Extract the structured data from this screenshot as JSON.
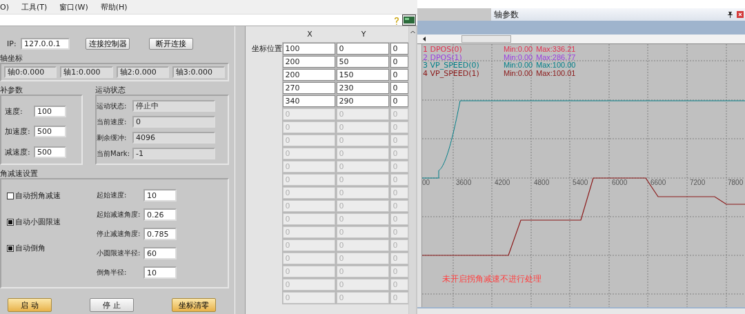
{
  "menu_bar": {
    "items": [
      "O)",
      "工具(T)",
      "窗口(W)",
      "帮助(H)"
    ]
  },
  "connection": {
    "ip_label": "IP:",
    "ip": "127.0.0.1",
    "buttons": [
      "连接控制器",
      "断开连接"
    ]
  },
  "axis_coords": {
    "title": "轴坐标",
    "fields": [
      "轴0:0.000",
      "轴1:0.000",
      "轴2:0.000",
      "轴3:0.000"
    ]
  },
  "interp_params": {
    "title": "补参数",
    "fields": [
      {
        "label": "速度:",
        "value": "100"
      },
      {
        "label": "加速度:",
        "value": "500"
      },
      {
        "label": "减速度:",
        "value": "500"
      }
    ]
  },
  "motion_status": {
    "title": "运动状态",
    "fields": [
      {
        "label": "运动状态:",
        "value": "停止中"
      },
      {
        "label": "当前速度:",
        "value": "0"
      },
      {
        "label": "剩余缓冲:",
        "value": "4096"
      },
      {
        "label": "当前Mark:",
        "value": "-1"
      }
    ]
  },
  "corner_decel": {
    "title": "角减速设置",
    "checkboxes": [
      {
        "label": "自动拐角减速",
        "checked": false
      },
      {
        "label": "自动小圆限速",
        "checked": true
      },
      {
        "label": "自动倒角",
        "checked": true
      }
    ],
    "fields": [
      {
        "label": "起始速度:",
        "value": "10"
      },
      {
        "label": "起始减速角度:",
        "value": "0.26"
      },
      {
        "label": "停止减速角度:",
        "value": "0.785"
      },
      {
        "label": "小圆限速半径:",
        "value": "60"
      },
      {
        "label": "倒角半径:",
        "value": "10"
      }
    ]
  },
  "action_buttons": [
    {
      "label": "启 动",
      "kind": "primary"
    },
    {
      "label": "停 止",
      "kind": "normal"
    },
    {
      "label": "坐标清零",
      "kind": "primary"
    }
  ],
  "coordinate_table": {
    "columns": [
      "X",
      "Y"
    ],
    "row_label": "坐标位置",
    "rows": [
      {
        "cells": [
          "100",
          "0",
          "0"
        ],
        "disabled": false
      },
      {
        "cells": [
          "200",
          "50",
          "0"
        ],
        "disabled": false
      },
      {
        "cells": [
          "200",
          "150",
          "0"
        ],
        "disabled": false
      },
      {
        "cells": [
          "270",
          "230",
          "0"
        ],
        "disabled": false
      },
      {
        "cells": [
          "340",
          "290",
          "0"
        ],
        "disabled": false
      },
      {
        "cells": [
          "0",
          "0",
          "0"
        ],
        "disabled": true
      },
      {
        "cells": [
          "0",
          "0",
          "0"
        ],
        "disabled": true
      },
      {
        "cells": [
          "0",
          "0",
          "0"
        ],
        "disabled": true
      },
      {
        "cells": [
          "0",
          "0",
          "0"
        ],
        "disabled": true
      },
      {
        "cells": [
          "0",
          "0",
          "0"
        ],
        "disabled": true
      },
      {
        "cells": [
          "0",
          "0",
          "0"
        ],
        "disabled": true
      },
      {
        "cells": [
          "0",
          "0",
          "0"
        ],
        "disabled": true
      },
      {
        "cells": [
          "0",
          "0",
          "0"
        ],
        "disabled": true
      },
      {
        "cells": [
          "0",
          "0",
          "0"
        ],
        "disabled": true
      },
      {
        "cells": [
          "0",
          "0",
          "0"
        ],
        "disabled": true
      },
      {
        "cells": [
          "0",
          "0",
          "0"
        ],
        "disabled": true
      },
      {
        "cells": [
          "0",
          "0",
          "0"
        ],
        "disabled": true
      },
      {
        "cells": [
          "0",
          "0",
          "0"
        ],
        "disabled": true
      },
      {
        "cells": [
          "0",
          "0",
          "0"
        ],
        "disabled": true
      },
      {
        "cells": [
          "0",
          "0",
          "0"
        ],
        "disabled": true
      }
    ]
  },
  "axis_panel": {
    "title": "轴参数"
  },
  "scope": {
    "legend": [
      {
        "name": "1 DPOS(0)",
        "min": "Min:0.00",
        "max": "Max:336.21",
        "color": "#e0304f"
      },
      {
        "name": "2 DPOS(1)",
        "min": "Min:0.00",
        "max": "Max:286.77",
        "color": "#9a3ee0"
      },
      {
        "name": "3 VP_SPEED(0)",
        "min": "Min:0.00",
        "max": "Max:100.00",
        "color": "#007f88"
      },
      {
        "name": "4 VP_SPEED(1)",
        "min": "Min:0.00",
        "max": "Max:100.01",
        "color": "#8a1616"
      }
    ],
    "x_tick_labels": [
      "00",
      "3600",
      "4200",
      "4800",
      "5400",
      "6000",
      "6600",
      "7200",
      "7800"
    ],
    "annotation": "未开启拐角减速不进行处理"
  }
}
